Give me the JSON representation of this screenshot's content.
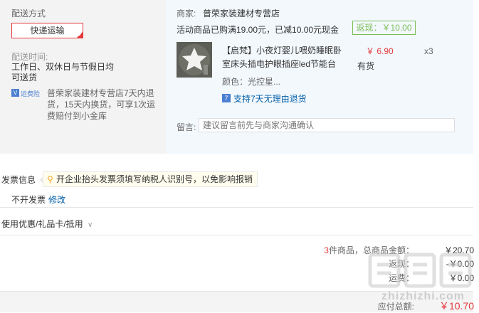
{
  "shipping": {
    "title": "配送方式",
    "method_button": "快递运输",
    "time_label": "配送时间:",
    "time_value_line1": "工作日、双休日与节假日均",
    "time_value_line2": "可送货",
    "insurance_badge": "运费险",
    "insurance_text_line1": "普荣家装建材专营店7天内退",
    "insurance_text_line2": "货，15天内换货，可享1次运",
    "insurance_text_line3": "费赔付到小金库"
  },
  "order": {
    "merchant_label": "商家:",
    "merchant_name": "普荣家装建材专营店",
    "promo_text": "活动商品已购满19.00元，已减10.00元现金",
    "cashback": "返现：￥10.00",
    "product": {
      "title_line1": "【启梵】小夜灯婴儿喂奶睡眠卧",
      "title_line2": "室床头插电护眼插座led节能台",
      "price": "￥ 6.90",
      "quantity": "x3",
      "stock": "有货",
      "color": "颜色：光控星..."
    },
    "return_policy": "支持7天无理由退货",
    "remark_label": "留言:",
    "remark_placeholder": "建议留言前先与商家沟通确认"
  },
  "invoice": {
    "title": "发票信息",
    "tip": "开企业抬头发票须填写纳税人识别号，以免影响报销",
    "status": "不开发票",
    "edit_link": "修改"
  },
  "discounts": {
    "toggle_label": "使用优惠/礼品卡/抵用"
  },
  "summary": {
    "count": "3",
    "count_suffix": "件商品，总商品金额：",
    "goods_total": "￥20.70",
    "row2_label": "返现：",
    "row2_value": "-￥0.00",
    "row3_label": "运费：",
    "row3_value": "￥0.00",
    "payable_label": "应付总额:",
    "payable_value": "￥10.70"
  },
  "watermark": {
    "text": "值|值|值",
    "url": "zhizhizhi.com"
  },
  "colors": {
    "accent": "#e4393c",
    "link": "#005ea7",
    "cashback_green": "#7abd54",
    "panel_gray": "#f3f3f3",
    "panel_blue": "#f3f8fd"
  }
}
